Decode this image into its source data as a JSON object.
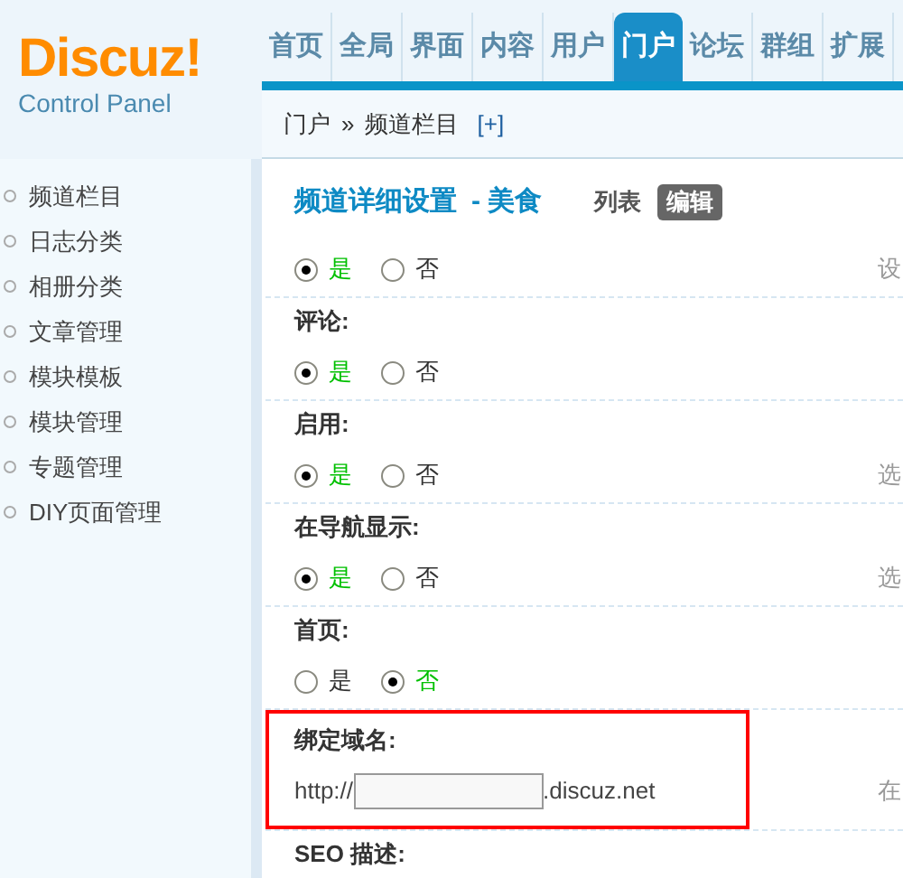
{
  "logo": {
    "name": "Discuz!",
    "subtitle": "Control Panel"
  },
  "nav_tabs": [
    {
      "label": "首页",
      "selected": false
    },
    {
      "label": "全局",
      "selected": false
    },
    {
      "label": "界面",
      "selected": false
    },
    {
      "label": "内容",
      "selected": false
    },
    {
      "label": "用户",
      "selected": false
    },
    {
      "label": "门户",
      "selected": true
    },
    {
      "label": "论坛",
      "selected": false
    },
    {
      "label": "群组",
      "selected": false
    },
    {
      "label": "扩展",
      "selected": false
    }
  ],
  "breadcrumb": {
    "items": [
      "门户",
      "频道栏目"
    ],
    "separator": "»",
    "add": "[+]"
  },
  "sidebar": {
    "items": [
      "频道栏目",
      "日志分类",
      "相册分类",
      "文章管理",
      "模块模板",
      "模块管理",
      "专题管理",
      "DIY页面管理"
    ]
  },
  "page": {
    "title": "频道详细设置",
    "subtitle": "- 美食",
    "actions": [
      {
        "label": "列表",
        "selected": false
      },
      {
        "label": "编辑",
        "selected": true
      }
    ]
  },
  "settings": [
    {
      "kind": "radio",
      "options": [
        {
          "label": "是",
          "selected": true
        },
        {
          "label": "否",
          "selected": false
        }
      ],
      "hint": "设"
    },
    {
      "kind": "radio",
      "label": "评论:",
      "options": [
        {
          "label": "是",
          "selected": true
        },
        {
          "label": "否",
          "selected": false
        }
      ]
    },
    {
      "kind": "radio",
      "label": "启用:",
      "options": [
        {
          "label": "是",
          "selected": true
        },
        {
          "label": "否",
          "selected": false
        }
      ],
      "hint": "选"
    },
    {
      "kind": "radio",
      "label": "在导航显示:",
      "options": [
        {
          "label": "是",
          "selected": true
        },
        {
          "label": "否",
          "selected": false
        }
      ],
      "hint": "选"
    },
    {
      "kind": "radio",
      "label": "首页:",
      "options": [
        {
          "label": "是",
          "selected": false
        },
        {
          "label": "否",
          "selected": true
        }
      ]
    },
    {
      "kind": "domain",
      "label": "绑定域名:",
      "prefix": "http://",
      "suffix": ".discuz.net",
      "hint": "在",
      "highlighted": true
    },
    {
      "kind": "heading",
      "label": "SEO 描述:"
    }
  ]
}
